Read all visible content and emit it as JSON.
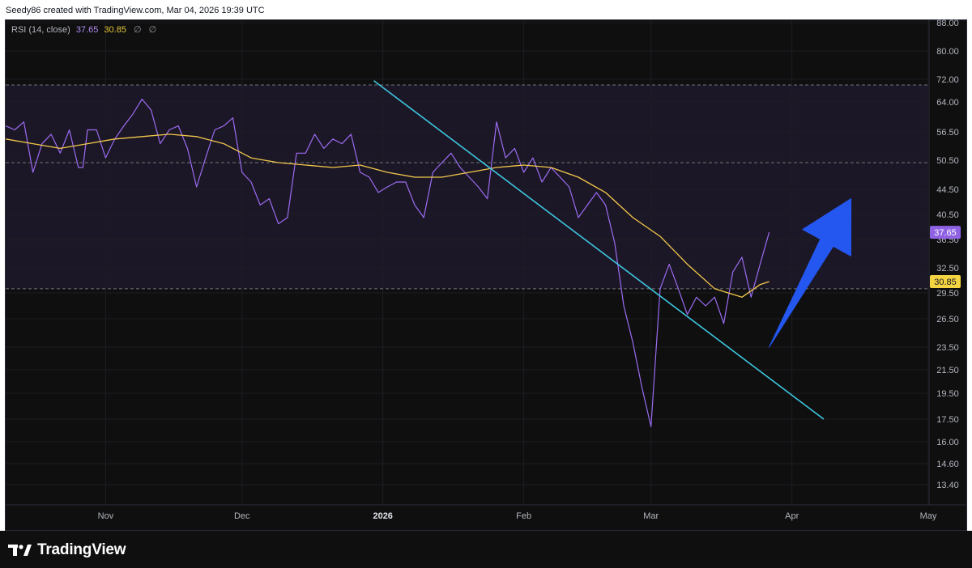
{
  "header": {
    "caption": "Seedy86 created with TradingView.com, Mar 04, 2026 19:39 UTC"
  },
  "legend": {
    "name": "RSI (14, close)",
    "rsi_value": "37.65",
    "ma_value": "30.85",
    "icon1": "∅",
    "icon2": "∅"
  },
  "footer": {
    "brand": "TradingView"
  },
  "colors": {
    "rsi": "#9b6cf2",
    "ma": "#f2c84b",
    "trendline": "#3ec6e0",
    "arrow": "#2457f0",
    "band": "#1c1726",
    "rsi_badge": "#8e62e3",
    "ma_badge": "#f5d442"
  },
  "chart_data": {
    "type": "line",
    "indicator": "RSI (14, close)",
    "y_ticks": [
      "88.00",
      "80.00",
      "72.00",
      "64.00",
      "56.50",
      "50.50",
      "44.50",
      "40.50",
      "36.50",
      "32.50",
      "29.50",
      "26.50",
      "23.50",
      "21.50",
      "19.50",
      "17.50",
      "16.00",
      "14.60",
      "13.40"
    ],
    "x_labels": [
      {
        "label": "Nov",
        "date": "2025-11-01",
        "bold": false
      },
      {
        "label": "Dec",
        "date": "2025-12-01",
        "bold": false
      },
      {
        "label": "2026",
        "date": "2026-01-01",
        "bold": true
      },
      {
        "label": "Feb",
        "date": "2026-02-01",
        "bold": false
      },
      {
        "label": "Mar",
        "date": "2026-03-01",
        "bold": false
      },
      {
        "label": "Apr",
        "date": "2026-04-01",
        "bold": false
      },
      {
        "label": "May",
        "date": "2026-05-01",
        "bold": false
      }
    ],
    "x_range": [
      "2025-10-10",
      "2026-05-01"
    ],
    "bands": {
      "upper": 70,
      "middle": 50,
      "lower": 30
    },
    "series": [
      {
        "name": "RSI",
        "last_label": "37.65",
        "values": [
          [
            "2025-10-10",
            58
          ],
          [
            "2025-10-12",
            57
          ],
          [
            "2025-10-14",
            59
          ],
          [
            "2025-10-16",
            48
          ],
          [
            "2025-10-18",
            54
          ],
          [
            "2025-10-20",
            56
          ],
          [
            "2025-10-22",
            52
          ],
          [
            "2025-10-24",
            57
          ],
          [
            "2025-10-26",
            49
          ],
          [
            "2025-10-27",
            49
          ],
          [
            "2025-10-28",
            57
          ],
          [
            "2025-10-30",
            57
          ],
          [
            "2025-11-01",
            51
          ],
          [
            "2025-11-03",
            55
          ],
          [
            "2025-11-05",
            58
          ],
          [
            "2025-11-07",
            61
          ],
          [
            "2025-11-09",
            65
          ],
          [
            "2025-11-11",
            62
          ],
          [
            "2025-11-13",
            54
          ],
          [
            "2025-11-15",
            57
          ],
          [
            "2025-11-17",
            58
          ],
          [
            "2025-11-19",
            53
          ],
          [
            "2025-11-21",
            45
          ],
          [
            "2025-11-23",
            51
          ],
          [
            "2025-11-25",
            57
          ],
          [
            "2025-11-27",
            58
          ],
          [
            "2025-11-29",
            60
          ],
          [
            "2025-12-01",
            48
          ],
          [
            "2025-12-03",
            46
          ],
          [
            "2025-12-05",
            42
          ],
          [
            "2025-12-07",
            43
          ],
          [
            "2025-12-09",
            39
          ],
          [
            "2025-12-11",
            40
          ],
          [
            "2025-12-13",
            52
          ],
          [
            "2025-12-15",
            52
          ],
          [
            "2025-12-17",
            56
          ],
          [
            "2025-12-19",
            53
          ],
          [
            "2025-12-21",
            55
          ],
          [
            "2025-12-23",
            54
          ],
          [
            "2025-12-25",
            56
          ],
          [
            "2025-12-27",
            48
          ],
          [
            "2025-12-29",
            47
          ],
          [
            "2025-12-31",
            44
          ],
          [
            "2026-01-02",
            45
          ],
          [
            "2026-01-04",
            46
          ],
          [
            "2026-01-06",
            46
          ],
          [
            "2026-01-08",
            42
          ],
          [
            "2026-01-10",
            40
          ],
          [
            "2026-01-12",
            48
          ],
          [
            "2026-01-14",
            50
          ],
          [
            "2026-01-16",
            52
          ],
          [
            "2026-01-18",
            49
          ],
          [
            "2026-01-20",
            47
          ],
          [
            "2026-01-22",
            45
          ],
          [
            "2026-01-24",
            43
          ],
          [
            "2026-01-26",
            59
          ],
          [
            "2026-01-28",
            51
          ],
          [
            "2026-01-30",
            53
          ],
          [
            "2026-02-01",
            48
          ],
          [
            "2026-02-03",
            51
          ],
          [
            "2026-02-05",
            46
          ],
          [
            "2026-02-07",
            49
          ],
          [
            "2026-02-09",
            47
          ],
          [
            "2026-02-11",
            45
          ],
          [
            "2026-02-13",
            40
          ],
          [
            "2026-02-15",
            42
          ],
          [
            "2026-02-17",
            44
          ],
          [
            "2026-02-19",
            42
          ],
          [
            "2026-02-21",
            36
          ],
          [
            "2026-02-23",
            28
          ],
          [
            "2026-02-25",
            24
          ],
          [
            "2026-02-27",
            20
          ],
          [
            "2026-03-01",
            17
          ],
          [
            "2026-03-03",
            30
          ],
          [
            "2026-03-05",
            33
          ],
          [
            "2026-03-07",
            30
          ],
          [
            "2026-03-09",
            27
          ],
          [
            "2026-03-11",
            29
          ],
          [
            "2026-03-13",
            28
          ],
          [
            "2026-03-15",
            29
          ],
          [
            "2026-03-17",
            26
          ],
          [
            "2026-03-19",
            32
          ],
          [
            "2026-03-21",
            34
          ],
          [
            "2026-03-23",
            29
          ],
          [
            "2026-03-25",
            33
          ],
          [
            "2026-03-27",
            37.65
          ]
        ]
      },
      {
        "name": "RSI-based MA",
        "last_label": "30.85",
        "values": [
          [
            "2025-10-10",
            55
          ],
          [
            "2025-10-16",
            54
          ],
          [
            "2025-10-22",
            53
          ],
          [
            "2025-10-28",
            54
          ],
          [
            "2025-11-03",
            55
          ],
          [
            "2025-11-09",
            55.5
          ],
          [
            "2025-11-15",
            56
          ],
          [
            "2025-11-21",
            55.5
          ],
          [
            "2025-11-27",
            54
          ],
          [
            "2025-12-03",
            51
          ],
          [
            "2025-12-09",
            50
          ],
          [
            "2025-12-15",
            49.5
          ],
          [
            "2025-12-21",
            49
          ],
          [
            "2025-12-27",
            49.5
          ],
          [
            "2026-01-02",
            48
          ],
          [
            "2026-01-08",
            47
          ],
          [
            "2026-01-14",
            47
          ],
          [
            "2026-01-20",
            48
          ],
          [
            "2026-01-26",
            49
          ],
          [
            "2026-02-01",
            49.5
          ],
          [
            "2026-02-07",
            49
          ],
          [
            "2026-02-13",
            47
          ],
          [
            "2026-02-19",
            44
          ],
          [
            "2026-02-25",
            40
          ],
          [
            "2026-03-03",
            37
          ],
          [
            "2026-03-09",
            33
          ],
          [
            "2026-03-15",
            30
          ],
          [
            "2026-03-21",
            29
          ],
          [
            "2026-03-25",
            30.5
          ],
          [
            "2026-03-27",
            30.85
          ]
        ]
      }
    ],
    "annotations": [
      {
        "type": "trendline",
        "from": [
          "2025-12-30",
          71.5
        ],
        "to": [
          "2026-04-08",
          17.5
        ]
      },
      {
        "type": "arrow",
        "from": [
          "2026-03-27",
          23.5
        ],
        "to": [
          "2026-04-14",
          43
        ]
      }
    ]
  }
}
